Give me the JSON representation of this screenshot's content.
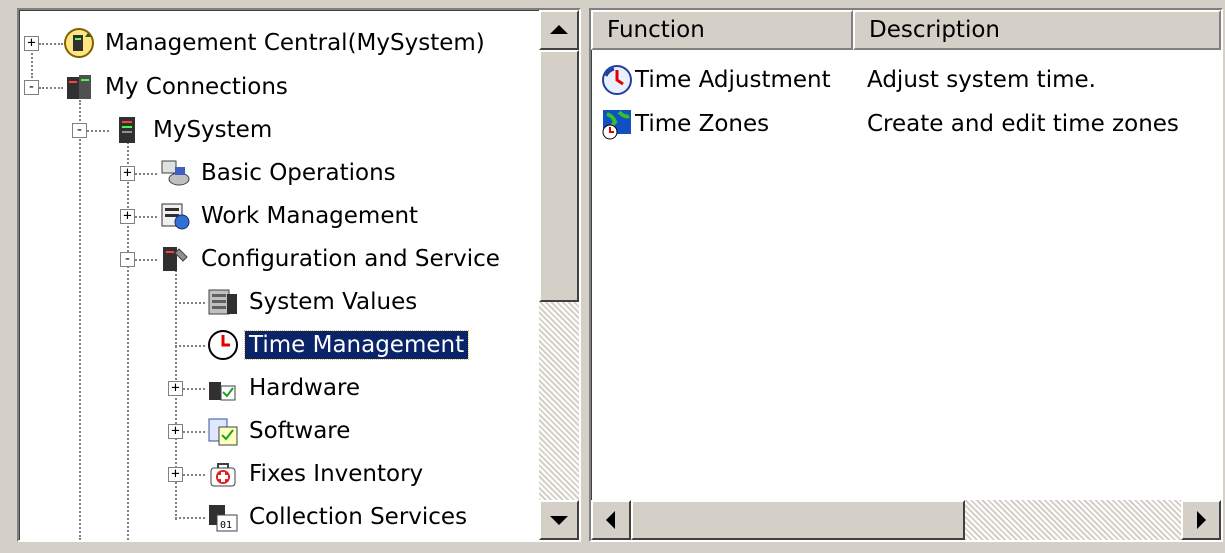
{
  "tree": {
    "items": [
      {
        "label": "Management Central(MySystem)",
        "icon": "management-central-icon",
        "expander": "+"
      },
      {
        "label": "My Connections",
        "icon": "connections-icon",
        "expander": "-"
      },
      {
        "label": "MySystem",
        "icon": "system-icon",
        "expander": "-"
      },
      {
        "label": "Basic Operations",
        "icon": "basic-operations-icon",
        "expander": "+"
      },
      {
        "label": "Work Management",
        "icon": "work-management-icon",
        "expander": "+"
      },
      {
        "label": "Configuration and Service",
        "icon": "configuration-service-icon",
        "expander": "-"
      },
      {
        "label": "System Values",
        "icon": "system-values-icon",
        "expander": ""
      },
      {
        "label": "Time Management",
        "icon": "clock-icon",
        "expander": "",
        "selected": true
      },
      {
        "label": "Hardware",
        "icon": "hardware-icon",
        "expander": "+"
      },
      {
        "label": "Software",
        "icon": "software-icon",
        "expander": "+"
      },
      {
        "label": "Fixes Inventory",
        "icon": "fixes-inventory-icon",
        "expander": "+"
      },
      {
        "label": "Collection Services",
        "icon": "collection-services-icon",
        "expander": ""
      }
    ]
  },
  "list": {
    "columns": [
      "Function",
      "Description"
    ],
    "rows": [
      {
        "function": "Time Adjustment",
        "description": "Adjust system time.",
        "icon": "time-adjustment-icon"
      },
      {
        "function": "Time Zones",
        "description": "Create and edit time zones",
        "icon": "time-zones-icon"
      }
    ]
  },
  "colors": {
    "selection": "#0a246a",
    "chrome": "#d4d0c8"
  }
}
